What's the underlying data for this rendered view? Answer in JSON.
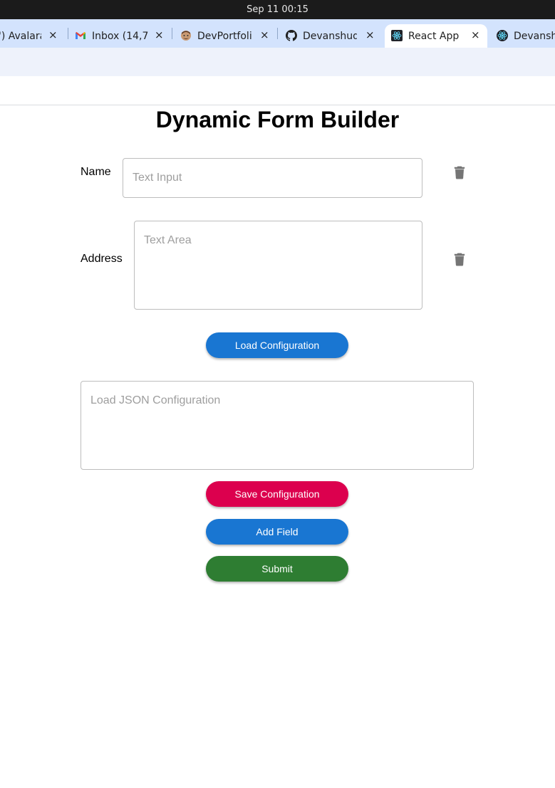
{
  "os": {
    "clock": "Sep 11  00:15"
  },
  "browser": {
    "tabs": [
      {
        "title": "') Avalara",
        "close": "×",
        "icon": "avalara-icon"
      },
      {
        "title": "Inbox (14,7",
        "close": "×",
        "icon": "gmail-icon"
      },
      {
        "title": "DevPortfoli",
        "close": "×",
        "icon": "avatar-icon"
      },
      {
        "title": "Devanshud",
        "close": "×",
        "icon": "github-icon"
      },
      {
        "title": "React App",
        "close": "×",
        "icon": "react-icon",
        "active": true
      },
      {
        "title": "Devansh",
        "close": "×",
        "icon": "react-icon"
      }
    ]
  },
  "page": {
    "title": "Dynamic Form Builder",
    "fields": [
      {
        "label": "Name",
        "placeholder": "Text Input",
        "type": "text"
      },
      {
        "label": "Address",
        "placeholder": "Text Area",
        "type": "textarea"
      }
    ],
    "load_button": "Load Configuration",
    "json_placeholder": "Load JSON Configuration",
    "save_button": "Save Configuration",
    "add_button": "Add Field",
    "submit_button": "Submit"
  },
  "colors": {
    "primary": "#1976d2",
    "secondary": "#dc004e",
    "success": "#2e7d32",
    "trash": "#757575"
  }
}
